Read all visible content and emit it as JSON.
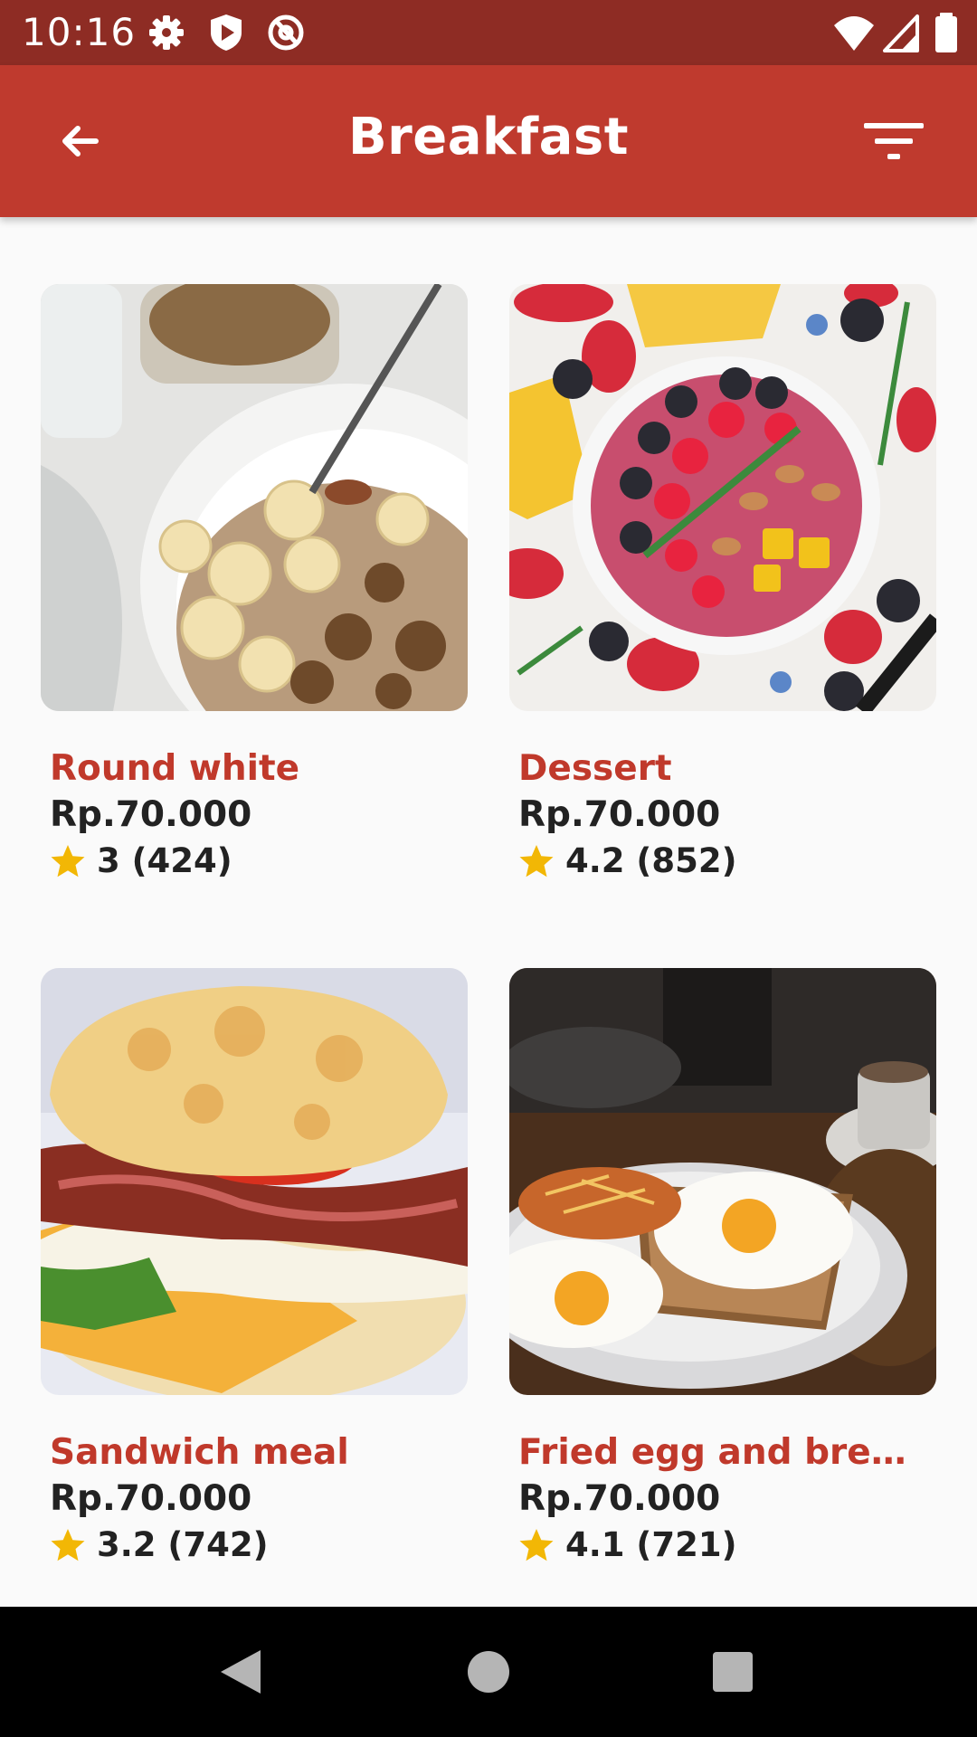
{
  "status_bar": {
    "time": "10:16",
    "left_icons": [
      "settings-icon",
      "shield-play-icon",
      "at-sign-icon"
    ],
    "right_icons": [
      "wifi-icon",
      "signal-icon",
      "battery-icon"
    ]
  },
  "app_bar": {
    "title": "Breakfast",
    "back_icon": "arrow-left-icon",
    "filter_icon": "filter-icon",
    "background_color": "#bf3a2e"
  },
  "items": [
    {
      "name": "Round white",
      "price": "Rp.70.000",
      "rating": "3 (424)",
      "image": "granola-banana-bowl"
    },
    {
      "name": "Dessert",
      "price": "Rp.70.000",
      "rating": "4.2 (852)",
      "image": "smoothie-berry-bowl"
    },
    {
      "name": "Sandwich meal",
      "price": "Rp.70.000",
      "rating": "3.2 (742)",
      "image": "biscuit-bacon-egg-sandwich"
    },
    {
      "name": "Fried egg and bread ...",
      "price": "Rp.70.000",
      "rating": "4.1 (721)",
      "image": "fried-egg-toast-plate"
    }
  ],
  "colors": {
    "item_name": "#c0392b",
    "star": "#f2b705"
  },
  "nav_bar": {
    "icons": [
      "nav-back-icon",
      "nav-home-icon",
      "nav-recents-icon"
    ]
  }
}
